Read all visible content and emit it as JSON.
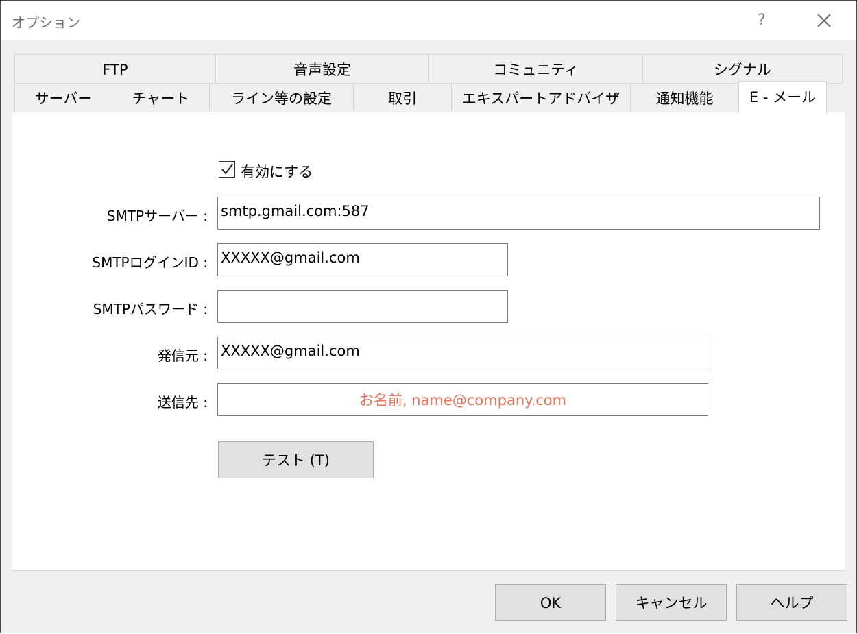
{
  "window": {
    "title": "オプション",
    "help_label": "?"
  },
  "tabs": {
    "row_top": [
      "FTP",
      "音声設定",
      "コミュニティ",
      "シグナル"
    ],
    "row_bottom": [
      "サーバー",
      "チャート",
      "ライン等の設定",
      "取引",
      "エキスパートアドバイザ",
      "通知機能",
      "E - メール"
    ],
    "active": "E - メール"
  },
  "form": {
    "enable_label": "有効にする",
    "enable_checked": true,
    "smtp_server_label": "SMTPサーバー :",
    "smtp_server_value": "smtp.gmail.com:587",
    "smtp_login_label": "SMTPログインID :",
    "smtp_login_value": "XXXXX@gmail.com",
    "smtp_password_label": "SMTPパスワード :",
    "smtp_password_value": "",
    "from_label": "発信元 :",
    "from_value": "XXXXX@gmail.com",
    "to_label": "送信先 :",
    "to_value": "お名前, name@company.com",
    "test_button": "テスト (T)"
  },
  "buttons": {
    "ok": "OK",
    "cancel": "キャンセル",
    "help": "ヘルプ"
  },
  "colors": {
    "to_text": "#e8735a"
  }
}
